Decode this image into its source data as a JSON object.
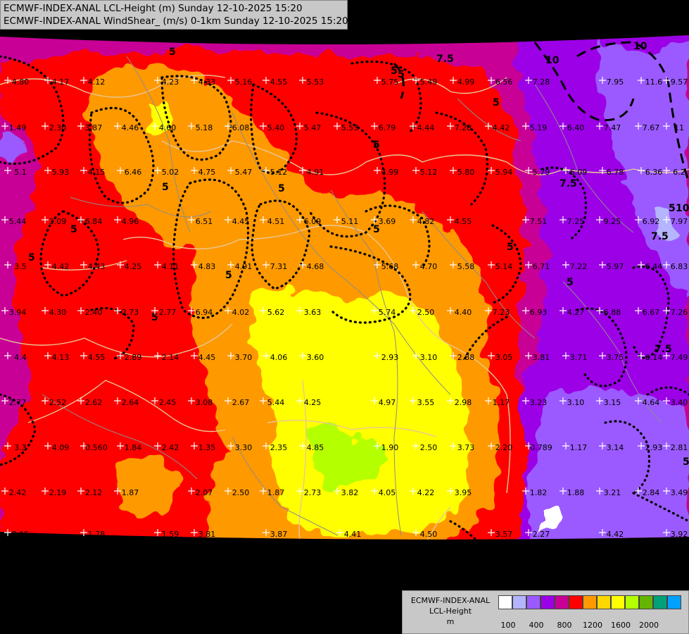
{
  "header": {
    "line1": "ECMWF-INDEX-ANAL LCL-Height (m) Sunday 12-10-2025 15:20",
    "line2": "ECMWF-INDEX-ANAL WindShear_ (m/s) 0-1km Sunday 12-10-2025 15:20"
  },
  "legend": {
    "model": "ECMWF-INDEX-ANAL",
    "parameter": "LCL-Height",
    "unit": "m",
    "colors": [
      "#ffffff",
      "#b4b4ff",
      "#9b5aff",
      "#9b00e6",
      "#c80096",
      "#ff0000",
      "#ff9900",
      "#ffd700",
      "#ffff00",
      "#b4ff00",
      "#64b400",
      "#00a078",
      "#00a0ff"
    ],
    "tick_labels": [
      "100",
      "400",
      "800",
      "1200",
      "1600",
      "2000"
    ]
  },
  "contours": {
    "isotach_labels": [
      "5",
      "5",
      "5",
      "5",
      "5",
      "5",
      "5",
      "5",
      "5",
      "5",
      "5",
      "5",
      "5",
      "5",
      "5",
      "5",
      "7.5",
      "7.5",
      "7.5",
      "7.5",
      "10",
      "10",
      "10"
    ]
  },
  "station_values": [
    {
      "row": 1,
      "values": [
        "4.80",
        "4.17",
        "4.12",
        "4.23",
        "4.33",
        "5.16",
        "4.55",
        "5.53",
        "5.75",
        "5.49",
        "4.99",
        "6.56",
        "7.28",
        "7.95",
        "11.6",
        "9.57"
      ]
    },
    {
      "row": 2,
      "values": [
        "1.49",
        "2.30",
        "3.87",
        "4.46",
        "4.60",
        "5.18",
        "6.08",
        "5.40",
        "5.47",
        "5.53",
        "6.79",
        "4.44",
        "7.28",
        "4.42",
        "5.19",
        "6.40",
        "7.47",
        "7.67",
        "11"
      ]
    },
    {
      "row": 3,
      "values": [
        "5.1",
        "5.93",
        "4.15",
        "6.46",
        "5.02",
        "4.75",
        "5.47",
        "5.12",
        "4.91",
        "4.99",
        "5.12",
        "5.80",
        "5.94",
        "5.79",
        "6.09",
        "6.78",
        "6.36",
        "6.2"
      ]
    },
    {
      "row": 4,
      "values": [
        "5.44",
        "3.09",
        "6.84",
        "4.96",
        "6.51",
        "4.45",
        "4.51",
        "6.09",
        "5.11",
        "3.69",
        "4.82",
        "4.55",
        "7.51",
        "7.25",
        "9.25",
        "6.92",
        "7.97"
      ]
    },
    {
      "row": 5,
      "values": [
        "3.5",
        "4.42",
        "4.43",
        "4.25",
        "4.11",
        "4.83",
        "4.91",
        "7.31",
        "4.68",
        "5.68",
        "4.70",
        "5.58",
        "5.14",
        "6.71",
        "7.22",
        "5.97",
        "6.44",
        "6.83"
      ]
    },
    {
      "row": 6,
      "values": [
        "3.94",
        "4.30",
        "2.40",
        "2.73",
        "2.77",
        "6.94",
        "4.02",
        "5.62",
        "3.63",
        "5.74",
        "2.50",
        "4.40",
        "7.23",
        "6.93",
        "4.27",
        "6.88",
        "6.67",
        "7.26"
      ]
    },
    {
      "row": 7,
      "values": [
        "4.4",
        "4.13",
        "4.55",
        "2.89",
        "2.14",
        "4.45",
        "3.70",
        "4.06",
        "3.60",
        "2.93",
        "3.10",
        "2.88",
        "3.05",
        "3.81",
        "3.71",
        "3.75",
        "6.14",
        "7.49"
      ]
    },
    {
      "row": 8,
      "values": [
        "2.77",
        "2.52",
        "2.62",
        "2.64",
        "2.45",
        "3.08",
        "2.67",
        "5.44",
        "4.25",
        "4.97",
        "3.55",
        "2.98",
        "1.17",
        "3.23",
        "3.10",
        "3.15",
        "4.64",
        "3.40"
      ]
    },
    {
      "row": 9,
      "values": [
        "3.3",
        "4.09",
        "0.560",
        "1.84",
        "2.42",
        "1.35",
        "3.30",
        "2.35",
        "4.85",
        "1.90",
        "2.50",
        "3.73",
        "2.20",
        "0.789",
        "1.17",
        "3.14",
        "2.93",
        "2.81"
      ]
    },
    {
      "row": 10,
      "values": [
        "2.42",
        "2.19",
        "2.12",
        "1.87",
        "2.07",
        "2.50",
        "1.87",
        "2.73",
        "3.82",
        "4.05",
        "4.22",
        "3.95",
        "1.82",
        "1.88",
        "3.21",
        "2.84",
        "3.49"
      ]
    },
    {
      "row": 11,
      "values": [
        "3.15",
        "1.78",
        "1.59",
        "3.81",
        "3.87",
        "4.41",
        "4.50",
        "3.57",
        "2.27",
        "4.42",
        "3.92"
      ]
    }
  ]
}
